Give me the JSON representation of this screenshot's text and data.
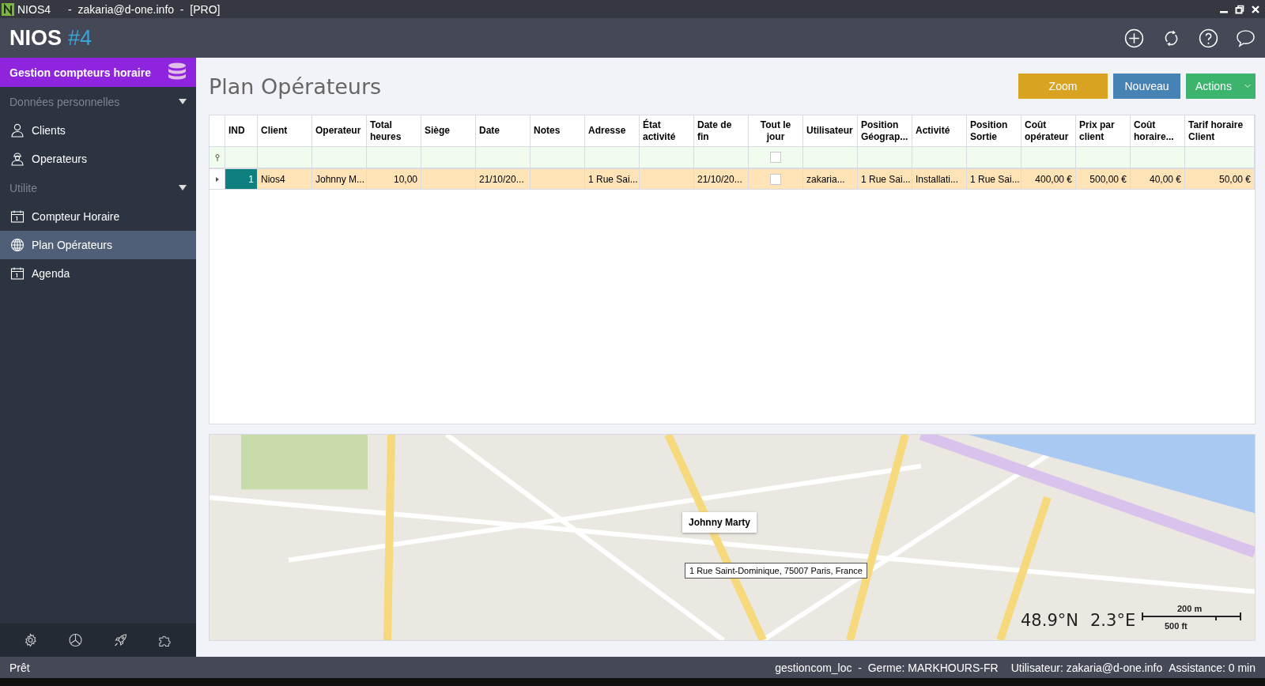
{
  "window": {
    "app_name": "NIOS4",
    "title": "-  zakaria@d-one.info  -  [PRO]"
  },
  "header": {
    "logo": "NIOS",
    "logo_suffix": "#4"
  },
  "sidebar": {
    "module": "Gestion compteurs horaire",
    "sections": [
      {
        "label": "Données personnelles",
        "expanded": true,
        "items": [
          {
            "label": "Clients",
            "kind": "person",
            "selected": false
          },
          {
            "label": "Operateurs",
            "kind": "worker",
            "selected": false
          }
        ]
      },
      {
        "label": "Utilite",
        "expanded": true,
        "items": [
          {
            "label": "Compteur Horaire",
            "kind": "calendar",
            "selected": false
          },
          {
            "label": "Plan Opérateurs",
            "kind": "globe",
            "selected": true
          },
          {
            "label": "Agenda",
            "kind": "calendar",
            "selected": false
          }
        ]
      }
    ]
  },
  "page": {
    "title": "Plan Opérateurs",
    "buttons": [
      {
        "label": "Zoom",
        "kind": "zoom"
      },
      {
        "label": "Nouveau",
        "kind": "new"
      },
      {
        "label": "Actions",
        "kind": "menu"
      }
    ]
  },
  "table": {
    "columns": [
      {
        "label": "IND",
        "kind": "number"
      },
      {
        "label": "Client",
        "kind": "text"
      },
      {
        "label": "Operateur",
        "kind": "text"
      },
      {
        "label": "Total heures",
        "kind": "number"
      },
      {
        "label": "Siège",
        "kind": "text"
      },
      {
        "label": "Date",
        "kind": "text"
      },
      {
        "label": "Notes",
        "kind": "text"
      },
      {
        "label": "Adresse",
        "kind": "text"
      },
      {
        "label": "État activité",
        "kind": "text"
      },
      {
        "label": "Date de fin",
        "kind": "text"
      },
      {
        "label": "Tout le jour",
        "kind": "check"
      },
      {
        "label": "Utilisateur",
        "kind": "text"
      },
      {
        "label": "Position Géograp...",
        "kind": "text"
      },
      {
        "label": "Activité",
        "kind": "text"
      },
      {
        "label": "Position Sortie",
        "kind": "text"
      },
      {
        "label": "Coût opérateur",
        "kind": "number"
      },
      {
        "label": "Prix par client",
        "kind": "number"
      },
      {
        "label": "Coût horaire...",
        "kind": "number"
      },
      {
        "label": "Tarif horaire Client",
        "kind": "number"
      }
    ],
    "filter_row": {
      "tout_le_jour_checked": false
    },
    "rows": [
      {
        "selected": true,
        "checked": false,
        "cells": [
          "1",
          "Nios4",
          "Johnny M...",
          "10,00",
          "",
          "21/10/20...",
          "",
          "1 Rue Sai...",
          "",
          "21/10/20...",
          "",
          "zakaria...",
          "1 Rue Sai...",
          "Installati...",
          "1 Rue Sai...",
          "400,00 €",
          "500,00 €",
          "40,00 €",
          "50,00 €"
        ]
      }
    ]
  },
  "map": {
    "marker_label": "Johnny Marty",
    "address": "1 Rue Saint-Dominique, 75007 Paris, France",
    "latitude": "48.9°N",
    "longitude": "2.3°E",
    "scale_metric": "200 m",
    "scale_imperial": "500 ft"
  },
  "status_bar": {
    "status": "Prêt",
    "database": "gestioncom_loc  -  Germe: MARKHOURS-FR",
    "user": "Utilisateur: zakaria@d-one.info",
    "assistance": "Assistance: 0 min"
  }
}
